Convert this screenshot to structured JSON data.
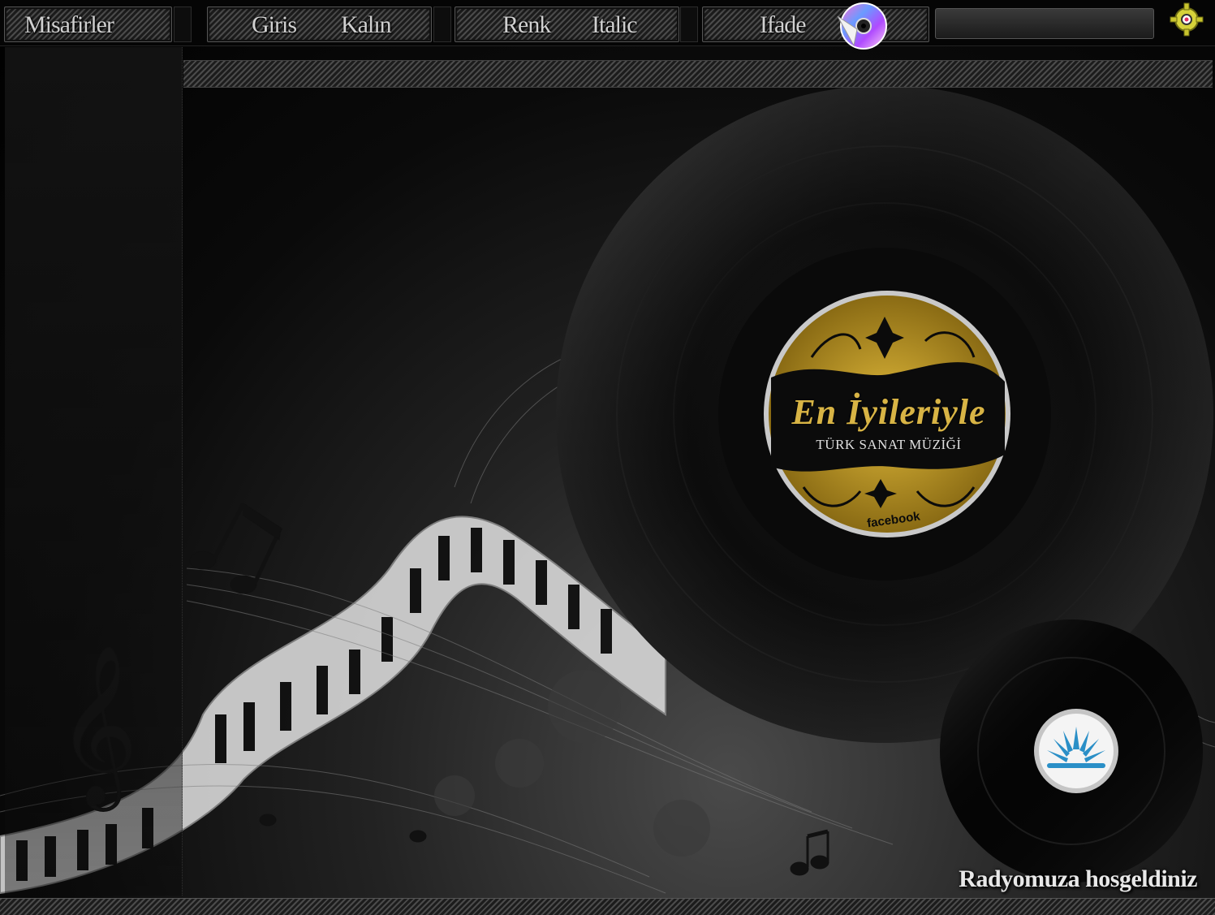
{
  "toolbar": {
    "guests_label": "Misafirler",
    "login_label": "Giris",
    "bold_label": "Kalın",
    "color_label": "Renk",
    "italic_label": "Italic",
    "emote_label": "Ifade",
    "message_input_value": ""
  },
  "icons": {
    "disc": "cd-disc-icon",
    "settings": "settings-icon"
  },
  "record": {
    "label_title": "En İyileriyle",
    "label_subtitle": "TÜRK SANAT MÜZİĞİ",
    "label_footer": "facebook"
  },
  "footer": {
    "welcome_text": "Radyomuza hosgeldiniz"
  },
  "colors": {
    "gold": "#c9a227",
    "label_dark": "#0b0b0b",
    "logo_blue": "#2a8fc7"
  }
}
